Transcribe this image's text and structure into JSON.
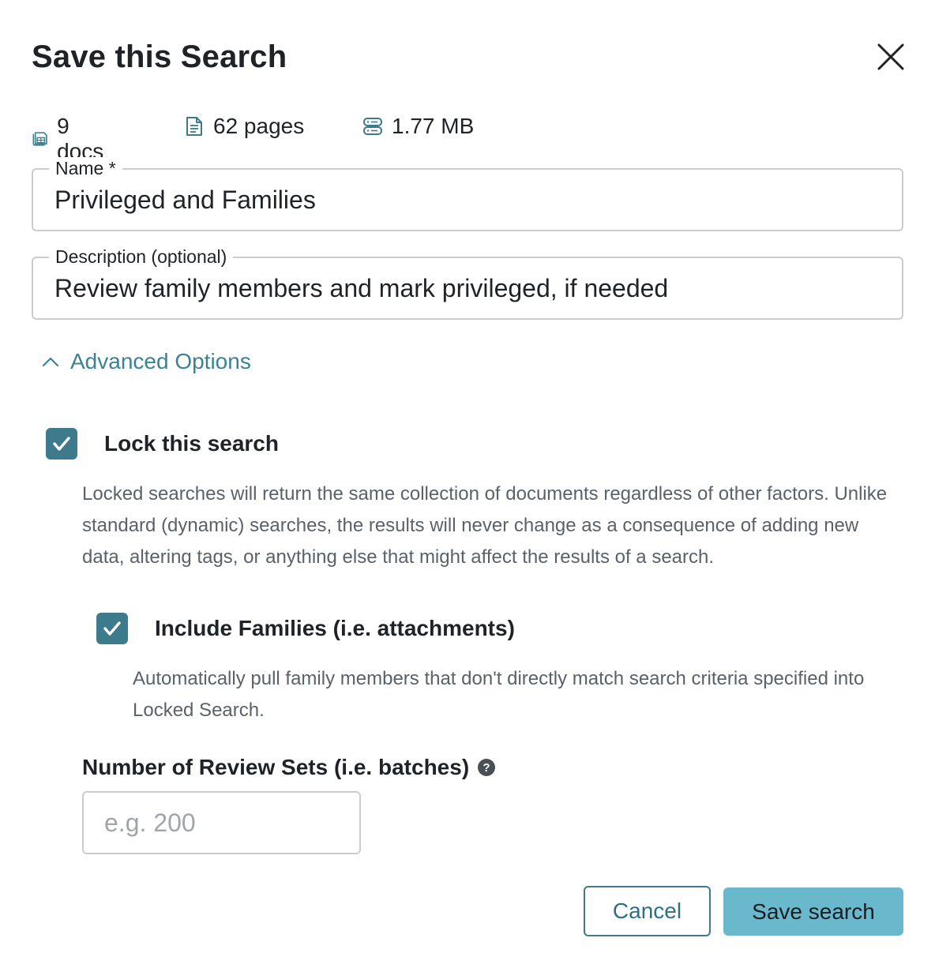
{
  "dialog": {
    "title": "Save this Search",
    "close_icon": "close-icon"
  },
  "stats": {
    "docs": {
      "icon": "documents-stack-icon",
      "label": "9 docs"
    },
    "pages": {
      "icon": "page-icon",
      "label": "62 pages"
    },
    "size": {
      "icon": "database-icon",
      "label": "1.77 MB"
    }
  },
  "form": {
    "name": {
      "label": "Name *",
      "value": "Privileged and Families"
    },
    "description": {
      "label": "Description (optional)",
      "value": "Review family members and mark privileged, if needed"
    }
  },
  "advanced": {
    "toggle_label": "Advanced Options",
    "toggle_icon": "chevron-up-icon",
    "lock": {
      "checked": true,
      "label": "Lock this search",
      "help": "Locked searches will return the same collection of documents regardless of other factors. Unlike standard (dynamic) searches, the results will never change as a consequence of adding new data, altering tags, or anything else that might affect the results of a search."
    },
    "families": {
      "checked": true,
      "label": "Include Families (i.e. attachments)",
      "help": "Automatically pull family members that don't directly match search criteria specified into Locked Search."
    },
    "batches": {
      "label": "Number of Review Sets (i.e. batches)",
      "help_icon": "question-circle-icon",
      "value": "",
      "placeholder": "e.g. 200"
    }
  },
  "actions": {
    "cancel_label": "Cancel",
    "save_label": "Save search"
  },
  "colors": {
    "accent": "#3d7a8c",
    "link": "#3a8296",
    "primary_button": "#6ab8cc",
    "border": "#c9cdd1"
  }
}
